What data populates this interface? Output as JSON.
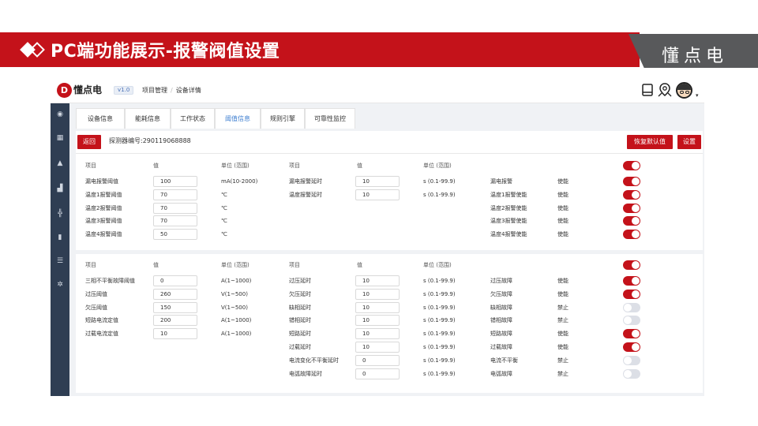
{
  "slide": {
    "title": "PC端功能展示-报警阀值设置",
    "brand": "懂点电"
  },
  "app": {
    "logo_text": "懂点电",
    "logo_letter": "D",
    "version": "v1.0",
    "breadcrumb": [
      "项目管理",
      "设备详情"
    ],
    "tabs": [
      "设备信息",
      "能耗信息",
      "工作状态",
      "阈值信息",
      "规则引擎",
      "可靠性监控"
    ],
    "active_tab": "阈值信息",
    "back_label": "返回",
    "detector_label": "探测器编号:290119068888",
    "reset_label": "恢复默认值",
    "set_label": "设置",
    "headers": {
      "item": "项目",
      "value": "值",
      "unit": "单位 (范围)"
    },
    "colors": {
      "accent": "#c4121a",
      "sidebar": "#2f3e53",
      "tab_active": "#3f7fd0"
    }
  },
  "panel1": {
    "header_toggle": true,
    "left_rows": [
      {
        "name": "漏电报警阈值",
        "value": "100",
        "unit": "mA(10-2000)"
      },
      {
        "name": "温度1报警阈值",
        "value": "70",
        "unit": "℃"
      },
      {
        "name": "温度2报警阈值",
        "value": "70",
        "unit": "℃"
      },
      {
        "name": "温度3报警阈值",
        "value": "70",
        "unit": "℃"
      },
      {
        "name": "温度4报警阈值",
        "value": "50",
        "unit": "℃"
      }
    ],
    "mid_rows": [
      {
        "name": "漏电报警延时",
        "value": "10",
        "unit": "s (0.1-99.9)"
      },
      {
        "name": "温度报警延时",
        "value": "10",
        "unit": "s (0.1-99.9)"
      }
    ],
    "right_rows": [
      {
        "name": "漏电报警",
        "state": "使能",
        "on": true
      },
      {
        "name": "温度1报警使能",
        "state": "使能",
        "on": true
      },
      {
        "name": "温度2报警使能",
        "state": "使能",
        "on": true
      },
      {
        "name": "温度3报警使能",
        "state": "使能",
        "on": true
      },
      {
        "name": "温度4报警使能",
        "state": "使能",
        "on": true
      }
    ]
  },
  "panel2": {
    "header_toggle": true,
    "left_rows": [
      {
        "name": "三相不平衡故障阈值",
        "value": "0",
        "unit": "A(1~1000)"
      },
      {
        "name": "过压阈值",
        "value": "260",
        "unit": "V(1~500)"
      },
      {
        "name": "欠压阈值",
        "value": "150",
        "unit": "V(1~500)"
      },
      {
        "name": "短路电流定值",
        "value": "200",
        "unit": "A(1~1000)"
      },
      {
        "name": "过载电流定值",
        "value": "10",
        "unit": "A(1~1000)"
      }
    ],
    "mid_rows": [
      {
        "name": "过压延时",
        "value": "10",
        "unit": "s (0.1-99.9)"
      },
      {
        "name": "欠压延时",
        "value": "10",
        "unit": "s (0.1-99.9)"
      },
      {
        "name": "缺相延时",
        "value": "10",
        "unit": "s (0.1-99.9)"
      },
      {
        "name": "错相延时",
        "value": "10",
        "unit": "s (0.1-99.9)"
      },
      {
        "name": "短路延时",
        "value": "10",
        "unit": "s (0.1-99.9)"
      },
      {
        "name": "过载延时",
        "value": "10",
        "unit": "s (0.1-99.9)"
      },
      {
        "name": "电流变化不平衡延时",
        "value": "0",
        "unit": "s (0.1-99.9)"
      },
      {
        "name": "电弧故障延时",
        "value": "0",
        "unit": "s (0.1-99.9)"
      }
    ],
    "right_rows": [
      {
        "name": "过压故障",
        "state": "使能",
        "on": true
      },
      {
        "name": "欠压故障",
        "state": "使能",
        "on": true
      },
      {
        "name": "缺相故障",
        "state": "禁止",
        "on": false
      },
      {
        "name": "错相故障",
        "state": "禁止",
        "on": false
      },
      {
        "name": "短路故障",
        "state": "使能",
        "on": true
      },
      {
        "name": "过载故障",
        "state": "使能",
        "on": true
      },
      {
        "name": "电流不平衡",
        "state": "禁止",
        "on": false
      },
      {
        "name": "电弧故障",
        "state": "禁止",
        "on": false
      }
    ]
  }
}
